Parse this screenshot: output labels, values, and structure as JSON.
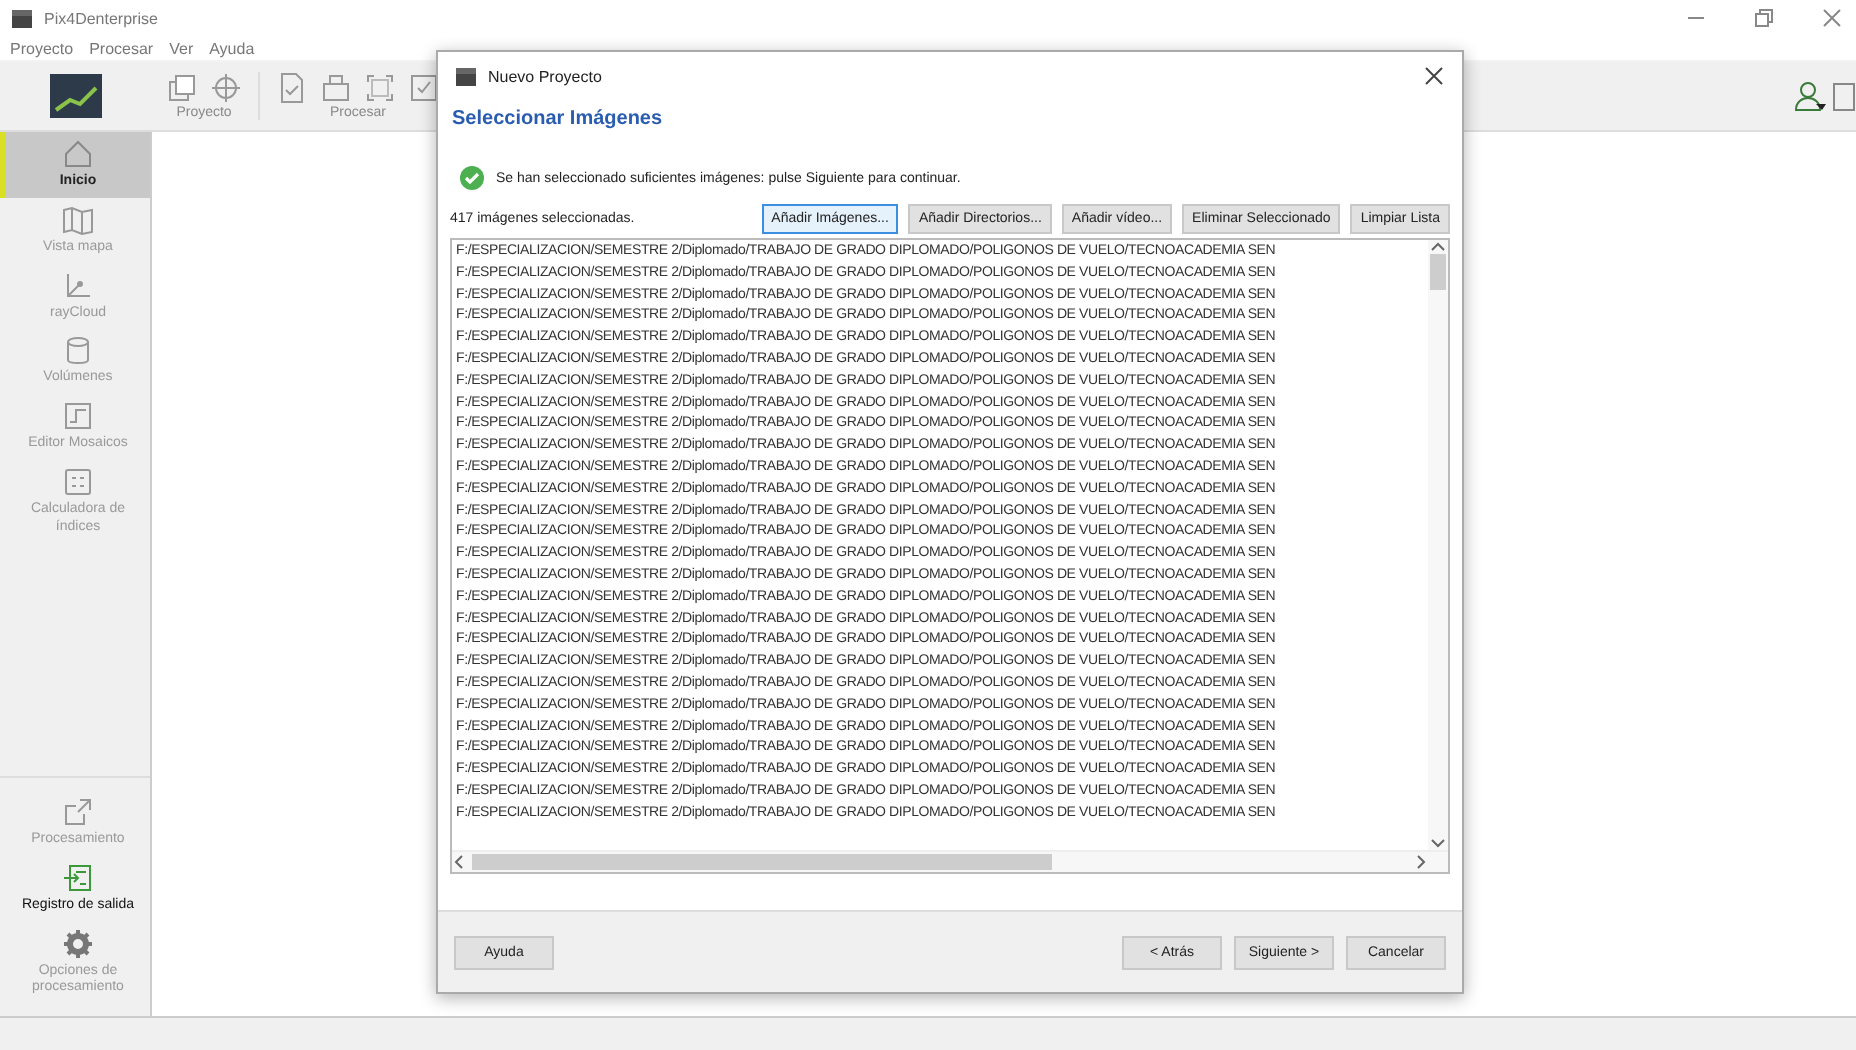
{
  "window": {
    "title": "Pix4Denterprise"
  },
  "menu": [
    "Proyecto",
    "Procesar",
    "Ver",
    "Ayuda"
  ],
  "toolbar": {
    "groups": [
      {
        "label": "Proyecto"
      },
      {
        "label": "Procesar"
      }
    ]
  },
  "sidebar": {
    "items": [
      {
        "label": "Inicio",
        "selected": true,
        "disabled": false
      },
      {
        "label": "Vista mapa",
        "selected": false,
        "disabled": true
      },
      {
        "label": "rayCloud",
        "selected": false,
        "disabled": true
      },
      {
        "label": "Volúmenes",
        "selected": false,
        "disabled": true
      },
      {
        "label": "Editor Mosaicos",
        "selected": false,
        "disabled": true
      },
      {
        "label": "Calculadora de índices",
        "selected": false,
        "disabled": true
      }
    ],
    "bottom_items": [
      {
        "label": "Procesamiento",
        "disabled": true
      },
      {
        "label": "Registro de salida",
        "disabled": false
      },
      {
        "label": "Opciones de procesamiento",
        "disabled": true
      }
    ]
  },
  "dialog": {
    "title": "Nuevo Proyecto",
    "heading": "Seleccionar Imágenes",
    "message": "Se han seleccionado suficientes imágenes: pulse Siguiente para continuar.",
    "count": "417 imágenes seleccionadas.",
    "buttons": [
      {
        "label": "Añadir Imágenes...",
        "focused": true
      },
      {
        "label": "Añadir Directorios...",
        "focused": false
      },
      {
        "label": "Añadir vídeo...",
        "focused": false
      },
      {
        "label": "Eliminar Seleccionado",
        "focused": false
      },
      {
        "label": "Limpiar Lista",
        "focused": false
      }
    ],
    "files": [
      "F:/ESPECIALIZACION/SEMESTRE 2/Diplomado/TRABAJO DE GRADO DIPLOMADO/POLIGONOS DE VUELO/TECNOACADEMIA SEN",
      "F:/ESPECIALIZACION/SEMESTRE 2/Diplomado/TRABAJO DE GRADO DIPLOMADO/POLIGONOS DE VUELO/TECNOACADEMIA SEN",
      "F:/ESPECIALIZACION/SEMESTRE 2/Diplomado/TRABAJO DE GRADO DIPLOMADO/POLIGONOS DE VUELO/TECNOACADEMIA SEN",
      "F:/ESPECIALIZACION/SEMESTRE 2/Diplomado/TRABAJO DE GRADO DIPLOMADO/POLIGONOS DE VUELO/TECNOACADEMIA SEN",
      "F:/ESPECIALIZACION/SEMESTRE 2/Diplomado/TRABAJO DE GRADO DIPLOMADO/POLIGONOS DE VUELO/TECNOACADEMIA SEN",
      "F:/ESPECIALIZACION/SEMESTRE 2/Diplomado/TRABAJO DE GRADO DIPLOMADO/POLIGONOS DE VUELO/TECNOACADEMIA SEN",
      "F:/ESPECIALIZACION/SEMESTRE 2/Diplomado/TRABAJO DE GRADO DIPLOMADO/POLIGONOS DE VUELO/TECNOACADEMIA SEN",
      "F:/ESPECIALIZACION/SEMESTRE 2/Diplomado/TRABAJO DE GRADO DIPLOMADO/POLIGONOS DE VUELO/TECNOACADEMIA SEN",
      "F:/ESPECIALIZACION/SEMESTRE 2/Diplomado/TRABAJO DE GRADO DIPLOMADO/POLIGONOS DE VUELO/TECNOACADEMIA SEN",
      "F:/ESPECIALIZACION/SEMESTRE 2/Diplomado/TRABAJO DE GRADO DIPLOMADO/POLIGONOS DE VUELO/TECNOACADEMIA SEN",
      "F:/ESPECIALIZACION/SEMESTRE 2/Diplomado/TRABAJO DE GRADO DIPLOMADO/POLIGONOS DE VUELO/TECNOACADEMIA SEN",
      "F:/ESPECIALIZACION/SEMESTRE 2/Diplomado/TRABAJO DE GRADO DIPLOMADO/POLIGONOS DE VUELO/TECNOACADEMIA SEN",
      "F:/ESPECIALIZACION/SEMESTRE 2/Diplomado/TRABAJO DE GRADO DIPLOMADO/POLIGONOS DE VUELO/TECNOACADEMIA SEN",
      "F:/ESPECIALIZACION/SEMESTRE 2/Diplomado/TRABAJO DE GRADO DIPLOMADO/POLIGONOS DE VUELO/TECNOACADEMIA SEN",
      "F:/ESPECIALIZACION/SEMESTRE 2/Diplomado/TRABAJO DE GRADO DIPLOMADO/POLIGONOS DE VUELO/TECNOACADEMIA SEN",
      "F:/ESPECIALIZACION/SEMESTRE 2/Diplomado/TRABAJO DE GRADO DIPLOMADO/POLIGONOS DE VUELO/TECNOACADEMIA SEN",
      "F:/ESPECIALIZACION/SEMESTRE 2/Diplomado/TRABAJO DE GRADO DIPLOMADO/POLIGONOS DE VUELO/TECNOACADEMIA SEN",
      "F:/ESPECIALIZACION/SEMESTRE 2/Diplomado/TRABAJO DE GRADO DIPLOMADO/POLIGONOS DE VUELO/TECNOACADEMIA SEN",
      "F:/ESPECIALIZACION/SEMESTRE 2/Diplomado/TRABAJO DE GRADO DIPLOMADO/POLIGONOS DE VUELO/TECNOACADEMIA SEN",
      "F:/ESPECIALIZACION/SEMESTRE 2/Diplomado/TRABAJO DE GRADO DIPLOMADO/POLIGONOS DE VUELO/TECNOACADEMIA SEN",
      "F:/ESPECIALIZACION/SEMESTRE 2/Diplomado/TRABAJO DE GRADO DIPLOMADO/POLIGONOS DE VUELO/TECNOACADEMIA SEN",
      "F:/ESPECIALIZACION/SEMESTRE 2/Diplomado/TRABAJO DE GRADO DIPLOMADO/POLIGONOS DE VUELO/TECNOACADEMIA SEN",
      "F:/ESPECIALIZACION/SEMESTRE 2/Diplomado/TRABAJO DE GRADO DIPLOMADO/POLIGONOS DE VUELO/TECNOACADEMIA SEN",
      "F:/ESPECIALIZACION/SEMESTRE 2/Diplomado/TRABAJO DE GRADO DIPLOMADO/POLIGONOS DE VUELO/TECNOACADEMIA SEN",
      "F:/ESPECIALIZACION/SEMESTRE 2/Diplomado/TRABAJO DE GRADO DIPLOMADO/POLIGONOS DE VUELO/TECNOACADEMIA SEN",
      "F:/ESPECIALIZACION/SEMESTRE 2/Diplomado/TRABAJO DE GRADO DIPLOMADO/POLIGONOS DE VUELO/TECNOACADEMIA SEN",
      "F:/ESPECIALIZACION/SEMESTRE 2/Diplomado/TRABAJO DE GRADO DIPLOMADO/POLIGONOS DE VUELO/TECNOACADEMIA SEN"
    ],
    "footer_buttons": [
      {
        "label": "Ayuda"
      },
      {
        "label": "< Atrás"
      },
      {
        "label": "Siguiente >"
      },
      {
        "label": "Cancelar"
      }
    ]
  }
}
